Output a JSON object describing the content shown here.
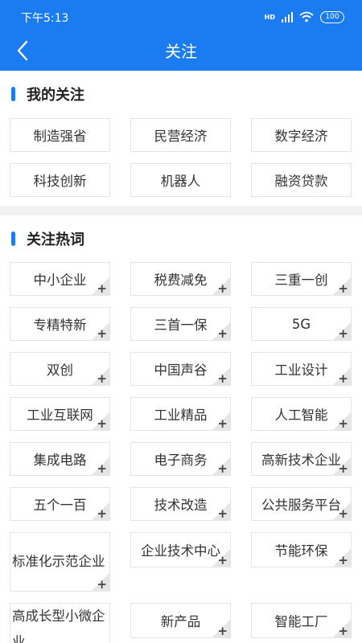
{
  "status_bar": {
    "time": "下午5:13",
    "network": "HD",
    "battery": "100"
  },
  "header": {
    "title": "关注",
    "back_icon": "chevron-left-icon"
  },
  "colors": {
    "primary": "#1b7bf0"
  },
  "my_follows": {
    "title": "我的关注",
    "items": [
      "制造强省",
      "民营经济",
      "数字经济",
      "科技创新",
      "机器人",
      "融资贷款"
    ]
  },
  "hot_words": {
    "title": "关注热词",
    "add_symbol": "+",
    "items": [
      "中小企业",
      "税费减免",
      "三重一创",
      "专精特新",
      "三首一保",
      "5G",
      "双创",
      "中国声谷",
      "工业设计",
      "工业互联网",
      "工业精品",
      "人工智能",
      "集成电路",
      "电子商务",
      "高新技术企业",
      "五个一百",
      "技术改造",
      "公共服务平台",
      "标准化示范企业",
      "企业技术中心",
      "节能环保",
      "高成长型小微企业",
      "新产品",
      "智能工厂"
    ]
  }
}
